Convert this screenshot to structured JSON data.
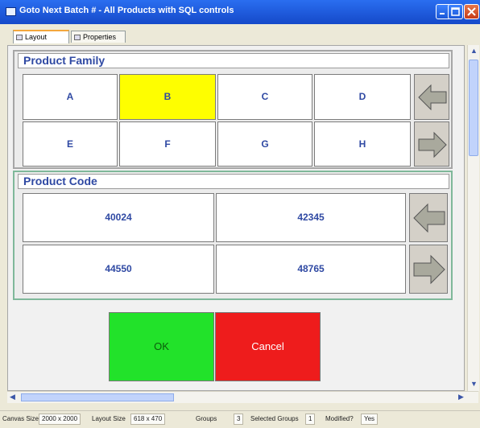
{
  "window": {
    "title": "Goto Next Batch # - All Products with SQL controls"
  },
  "tabs": [
    {
      "label": "Layout",
      "active": true
    },
    {
      "label": "Properties",
      "active": false
    }
  ],
  "product_family": {
    "title": "Product Family",
    "items": [
      "A",
      "B",
      "C",
      "D",
      "E",
      "F",
      "G",
      "H"
    ],
    "selected": "B"
  },
  "product_code": {
    "title": "Product Code",
    "items": [
      "40024",
      "42345",
      "44550",
      "48765"
    ]
  },
  "actions": {
    "ok_label": "OK",
    "cancel_label": "Cancel"
  },
  "status": {
    "canvas_size_label": "Canvas Size",
    "canvas_size_value": "2000 x 2000",
    "layout_size_label": "Layout Size",
    "layout_size_value": "618 x 470",
    "groups_label": "Groups",
    "groups_value": "3",
    "selected_groups_label": "Selected Groups",
    "selected_groups_value": "1",
    "modified_label": "Modified?",
    "modified_value": "Yes"
  },
  "colors": {
    "selected_cell": "#fefe00",
    "ok_button": "#22e22a",
    "cancel_button": "#ee1c1c",
    "cell_text": "#2f49a3",
    "title_bar": "#1f5fe3"
  },
  "icons": [
    "app-window-icon",
    "minimize-icon",
    "maximize-icon",
    "close-icon",
    "arrow-left-icon",
    "arrow-right-icon"
  ]
}
